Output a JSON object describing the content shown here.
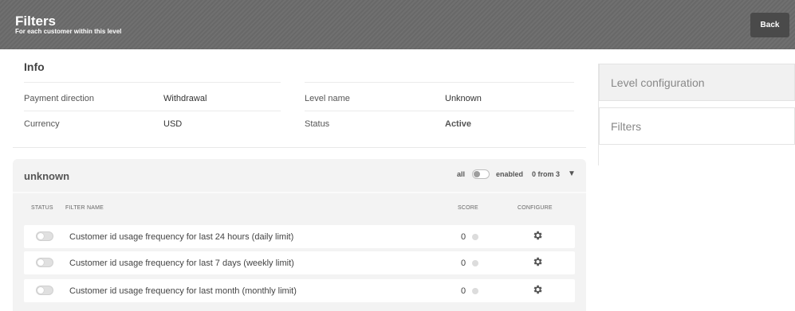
{
  "header": {
    "title": "Filters",
    "subtitle": "For each customer within this level",
    "back_label": "Back"
  },
  "info": {
    "heading": "Info",
    "payment_direction_label": "Payment direction",
    "payment_direction_value": "Withdrawal",
    "level_name_label": "Level name",
    "level_name_value": "Unknown",
    "currency_label": "Currency",
    "currency_value": "USD",
    "status_label": "Status",
    "status_value": "Active"
  },
  "sidebar": {
    "items": [
      {
        "label": "Level configuration"
      },
      {
        "label": "Filters"
      }
    ]
  },
  "group": {
    "title": "unknown",
    "all_label": "all",
    "enabled_label": "enabled",
    "count_text": "0 from 3",
    "expand_icon": "triangle-down-icon",
    "columns": {
      "status": "STATUS",
      "filter_name": "FILTER NAME",
      "score": "SCORE",
      "configure": "CONFIGURE"
    },
    "filters": [
      {
        "name": "Customer id usage frequency for last 24 hours (daily limit)",
        "score": "0",
        "enabled": false
      },
      {
        "name": "Customer id usage frequency for last 7 days (weekly limit)",
        "score": "0",
        "enabled": false
      },
      {
        "name": "Customer id usage frequency for last month (monthly limit)",
        "score": "0",
        "enabled": false
      }
    ]
  }
}
